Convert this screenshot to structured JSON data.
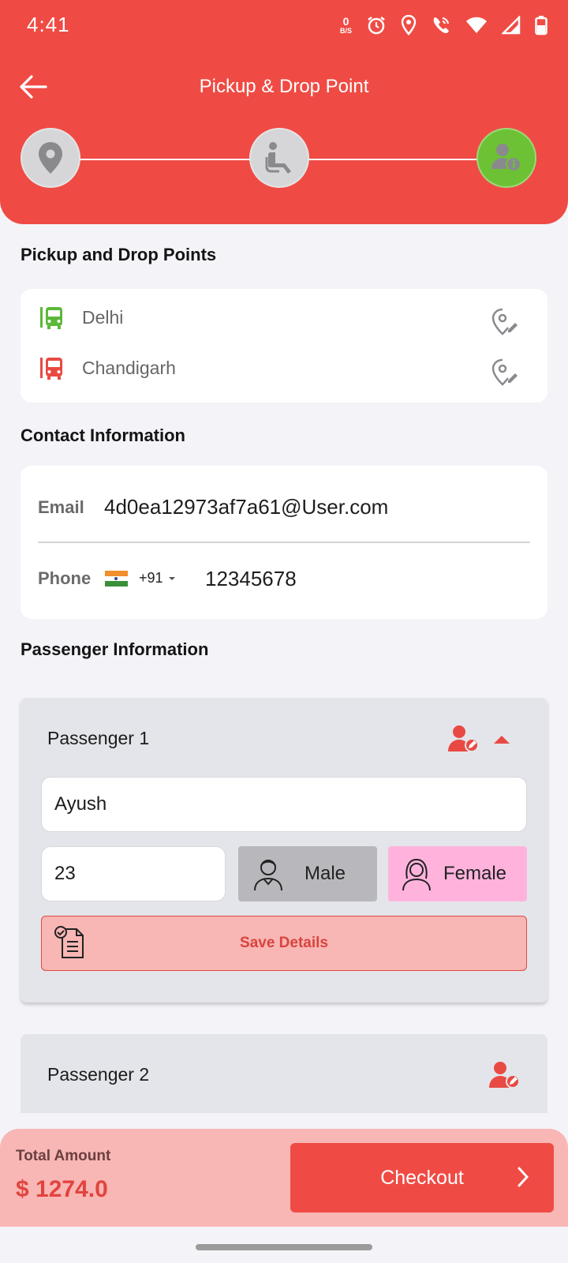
{
  "status_bar": {
    "time": "4:41",
    "net_speed_value": "0",
    "net_speed_unit": "B/S"
  },
  "header": {
    "title": "Pickup & Drop Point"
  },
  "steps": [
    {
      "icon": "location-pin-icon",
      "state": "completed"
    },
    {
      "icon": "seat-icon",
      "state": "completed"
    },
    {
      "icon": "passenger-info-icon",
      "state": "active"
    }
  ],
  "pickup_drop": {
    "section_title": "Pickup and Drop Points",
    "pickup": {
      "city": "Delhi",
      "icon": "bus-icon",
      "color": "#5cb83a"
    },
    "drop": {
      "city": "Chandigarh",
      "icon": "bus-icon",
      "color": "#e84a43"
    }
  },
  "contact": {
    "section_title": "Contact Information",
    "email_label": "Email",
    "email_value": "4d0ea12973af7a61@User.com",
    "phone_label": "Phone",
    "country_code": "+91",
    "phone_value": "12345678"
  },
  "passengers": {
    "section_title": "Passenger Information",
    "items": [
      {
        "title": "Passenger 1",
        "name": "Ayush",
        "age": "23",
        "gender_male": "Male",
        "gender_female": "Female",
        "save_label": "Save Details"
      },
      {
        "title": "Passenger 2"
      }
    ]
  },
  "footer": {
    "total_label": "Total Amount",
    "total_value": "$ 1274.0",
    "checkout_label": "Checkout"
  },
  "colors": {
    "primary": "#ef4b44",
    "active_step": "#6cc234",
    "female_selected": "#ffb3dc",
    "male_bg": "#b8b8bc"
  }
}
